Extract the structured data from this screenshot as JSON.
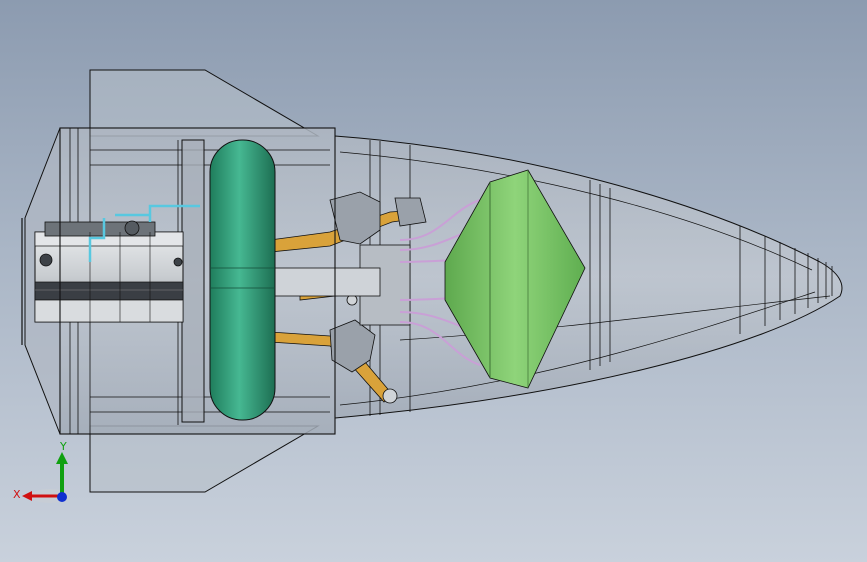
{
  "triad": {
    "x_label": "X",
    "y_label": "Y",
    "colors": {
      "x": "#d01010",
      "y": "#10a010",
      "z": "#1030d0"
    }
  },
  "colors": {
    "background_top": "#8c9bb0",
    "background_bottom": "#c9d1dc",
    "shell": "#b4bcc6",
    "torus_tank": "#2e9e78",
    "nose_cone_part": "#7cc46a",
    "struts": "#d9a23a",
    "wires": "#c9a0d6",
    "edges": "#111111"
  }
}
